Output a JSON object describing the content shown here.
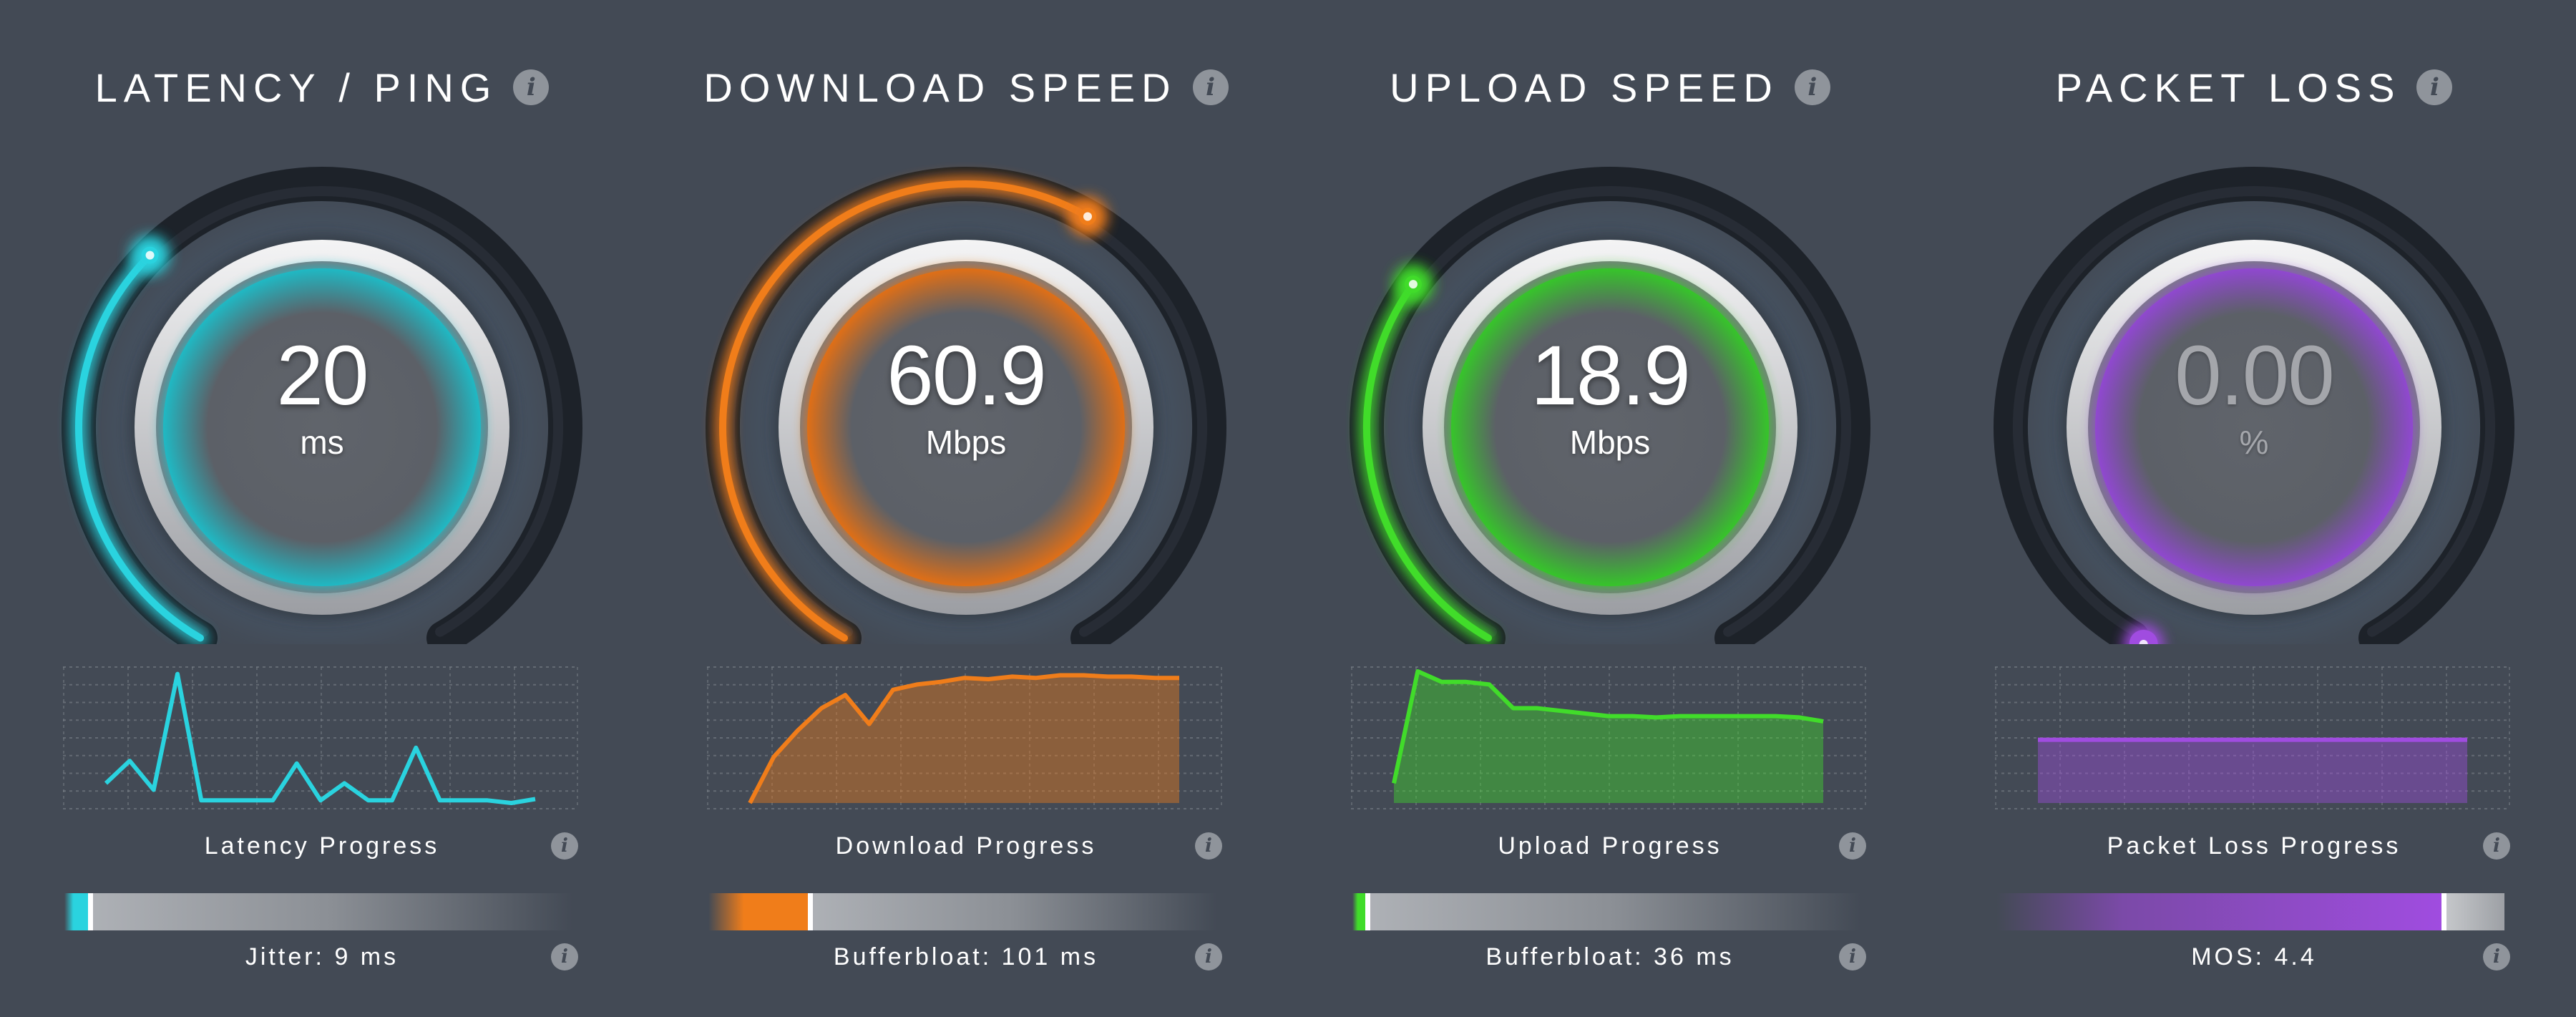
{
  "panels": [
    {
      "title": "LATENCY / PING",
      "value": "20",
      "unit": "ms",
      "accent": "#2ad3df",
      "inner_glow": "#1fb9c4",
      "gauge_fraction": 0.35,
      "graph_label": "Latency Progress",
      "graph_type": "line",
      "graph_values": [
        0.15,
        0.32,
        0.1,
        0.98,
        0.02,
        0.02,
        0.02,
        0.02,
        0.3,
        0.02,
        0.15,
        0.02,
        0.02,
        0.42,
        0.02,
        0.02,
        0.02,
        0.0,
        0.03
      ],
      "bar_label": "Jitter: 9 ms",
      "bar_fraction": 0.05
    },
    {
      "title": "DOWNLOAD SPEED",
      "value": "60.9",
      "unit": "Mbps",
      "accent": "#f07d1a",
      "inner_glow": "#e06f16",
      "gauge_fraction": 0.6,
      "graph_label": "Download Progress",
      "graph_type": "area",
      "graph_values": [
        0,
        0.35,
        0.55,
        0.72,
        0.82,
        0.6,
        0.86,
        0.9,
        0.92,
        0.95,
        0.94,
        0.96,
        0.95,
        0.97,
        0.97,
        0.96,
        0.96,
        0.95,
        0.95
      ],
      "bar_label": "Bufferbloat: 101 ms",
      "bar_fraction": 0.2
    },
    {
      "title": "UPLOAD SPEED",
      "value": "18.9",
      "unit": "Mbps",
      "accent": "#41dc2a",
      "inner_glow": "#36c52a",
      "gauge_fraction": 0.32,
      "graph_label": "Upload Progress",
      "graph_type": "area",
      "graph_values": [
        0.15,
        1.0,
        0.92,
        0.92,
        0.9,
        0.72,
        0.72,
        0.7,
        0.68,
        0.66,
        0.66,
        0.65,
        0.66,
        0.66,
        0.66,
        0.66,
        0.66,
        0.65,
        0.62
      ],
      "bar_label": "Bufferbloat: 36 ms",
      "bar_fraction": 0.03
    },
    {
      "title": "PACKET LOSS",
      "value": "0.00",
      "unit": "%",
      "accent": "#a04ce0",
      "inner_glow": "#9048d0",
      "gauge_fraction": 0.0,
      "graph_label": "Packet Loss Progress",
      "graph_type": "flat",
      "graph_values": [
        0.48,
        0.48
      ],
      "bar_label": "MOS: 4.4",
      "bar_fraction": 0.88
    }
  ]
}
